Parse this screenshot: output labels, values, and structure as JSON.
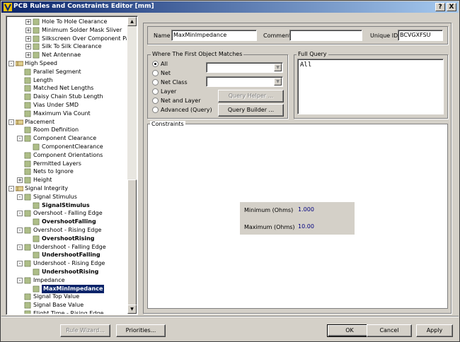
{
  "window": {
    "title": "PCB Rules and Constraints Editor [mm]",
    "help_btn": "?",
    "close_btn": "X"
  },
  "tree": {
    "items": [
      {
        "label": "Hole To Hole Clearance",
        "level": 3,
        "expander": "+",
        "icon": "rule-icon",
        "bold": false,
        "selected": false
      },
      {
        "label": "Minimum Solder Mask Sliver",
        "level": 3,
        "expander": "+",
        "icon": "rule-icon",
        "bold": false,
        "selected": false
      },
      {
        "label": "Silkscreen Over Component Pads",
        "level": 3,
        "expander": "+",
        "icon": "rule-icon",
        "bold": false,
        "selected": false
      },
      {
        "label": "Silk To Silk Clearance",
        "level": 3,
        "expander": "+",
        "icon": "rule-icon",
        "bold": false,
        "selected": false
      },
      {
        "label": "Net Antennae",
        "level": 3,
        "expander": "+",
        "icon": "rule-icon",
        "bold": false,
        "selected": false
      },
      {
        "label": "High Speed",
        "level": 1,
        "expander": "-",
        "icon": "category-icon",
        "bold": false,
        "selected": false
      },
      {
        "label": "Parallel Segment",
        "level": 2,
        "expander": "",
        "icon": "rule-icon",
        "bold": false,
        "selected": false
      },
      {
        "label": "Length",
        "level": 2,
        "expander": "",
        "icon": "rule-icon",
        "bold": false,
        "selected": false
      },
      {
        "label": "Matched Net Lengths",
        "level": 2,
        "expander": "",
        "icon": "rule-icon",
        "bold": false,
        "selected": false
      },
      {
        "label": "Daisy Chain Stub Length",
        "level": 2,
        "expander": "",
        "icon": "rule-icon",
        "bold": false,
        "selected": false
      },
      {
        "label": "Vias Under SMD",
        "level": 2,
        "expander": "",
        "icon": "rule-icon",
        "bold": false,
        "selected": false
      },
      {
        "label": "Maximum Via Count",
        "level": 2,
        "expander": "",
        "icon": "rule-icon",
        "bold": false,
        "selected": false
      },
      {
        "label": "Placement",
        "level": 1,
        "expander": "-",
        "icon": "category-icon",
        "bold": false,
        "selected": false
      },
      {
        "label": "Room Definition",
        "level": 2,
        "expander": "",
        "icon": "rule-icon",
        "bold": false,
        "selected": false
      },
      {
        "label": "Component Clearance",
        "level": 2,
        "expander": "-",
        "icon": "rule-icon",
        "bold": false,
        "selected": false
      },
      {
        "label": "ComponentClearance",
        "level": 3,
        "expander": "",
        "icon": "rule-icon",
        "bold": false,
        "selected": false
      },
      {
        "label": "Component Orientations",
        "level": 2,
        "expander": "",
        "icon": "rule-icon",
        "bold": false,
        "selected": false
      },
      {
        "label": "Permitted Layers",
        "level": 2,
        "expander": "",
        "icon": "rule-icon",
        "bold": false,
        "selected": false
      },
      {
        "label": "Nets to Ignore",
        "level": 2,
        "expander": "",
        "icon": "rule-icon",
        "bold": false,
        "selected": false
      },
      {
        "label": "Height",
        "level": 2,
        "expander": "+",
        "icon": "rule-icon",
        "bold": false,
        "selected": false
      },
      {
        "label": "Signal Integrity",
        "level": 1,
        "expander": "-",
        "icon": "category-icon",
        "bold": false,
        "selected": false
      },
      {
        "label": "Signal Stimulus",
        "level": 2,
        "expander": "-",
        "icon": "rule-icon",
        "bold": false,
        "selected": false
      },
      {
        "label": "SignalStimulus",
        "level": 3,
        "expander": "",
        "icon": "rule-icon",
        "bold": true,
        "selected": false
      },
      {
        "label": "Overshoot - Falling Edge",
        "level": 2,
        "expander": "-",
        "icon": "rule-icon",
        "bold": false,
        "selected": false
      },
      {
        "label": "OvershootFalling",
        "level": 3,
        "expander": "",
        "icon": "rule-icon",
        "bold": true,
        "selected": false
      },
      {
        "label": "Overshoot - Rising Edge",
        "level": 2,
        "expander": "-",
        "icon": "rule-icon",
        "bold": false,
        "selected": false
      },
      {
        "label": "OvershootRising",
        "level": 3,
        "expander": "",
        "icon": "rule-icon",
        "bold": true,
        "selected": false
      },
      {
        "label": "Undershoot - Falling Edge",
        "level": 2,
        "expander": "-",
        "icon": "rule-icon",
        "bold": false,
        "selected": false
      },
      {
        "label": "UndershootFalling",
        "level": 3,
        "expander": "",
        "icon": "rule-icon",
        "bold": true,
        "selected": false
      },
      {
        "label": "Undershoot - Rising Edge",
        "level": 2,
        "expander": "-",
        "icon": "rule-icon",
        "bold": false,
        "selected": false
      },
      {
        "label": "UndershootRising",
        "level": 3,
        "expander": "",
        "icon": "rule-icon",
        "bold": true,
        "selected": false
      },
      {
        "label": "Impedance",
        "level": 2,
        "expander": "-",
        "icon": "rule-icon",
        "bold": false,
        "selected": false
      },
      {
        "label": "MaxMinImpedance",
        "level": 3,
        "expander": "",
        "icon": "rule-icon",
        "bold": true,
        "selected": true
      },
      {
        "label": "Signal Top Value",
        "level": 2,
        "expander": "",
        "icon": "rule-icon",
        "bold": false,
        "selected": false
      },
      {
        "label": "Signal Base Value",
        "level": 2,
        "expander": "",
        "icon": "rule-icon",
        "bold": false,
        "selected": false
      },
      {
        "label": "Flight Time - Rising Edge",
        "level": 2,
        "expander": "",
        "icon": "rule-icon",
        "bold": false,
        "selected": false
      }
    ]
  },
  "rule": {
    "name_label": "Name",
    "name_value": "MaxMinImpedance",
    "comment_label": "Comment",
    "comment_value": "",
    "uid_label": "Unique ID",
    "uid_value": "BCVGXFSU"
  },
  "where": {
    "title": "Where The First Object Matches",
    "options": [
      "All",
      "Net",
      "Net Class",
      "Layer",
      "Net and Layer",
      "Advanced (Query)"
    ],
    "selected_option": "All",
    "query_helper": "Query Helper ...",
    "query_builder": "Query Builder ..."
  },
  "full_query": {
    "title": "Full Query",
    "text": "All"
  },
  "constraints": {
    "title": "Constraints",
    "min_label": "Minimum (Ohms)",
    "min_value": "1.000",
    "max_label": "Maximum (Ohms)",
    "max_value": "10.00"
  },
  "footer": {
    "rule_wizard": "Rule Wizard...",
    "priorities": "Priorities...",
    "ok": "OK",
    "cancel": "Cancel",
    "apply": "Apply"
  },
  "colors": {
    "title_start": "#0a246a",
    "title_end": "#a6caf0",
    "face": "#d4d0c8",
    "selection": "#0a246a",
    "value_text": "#000080"
  }
}
